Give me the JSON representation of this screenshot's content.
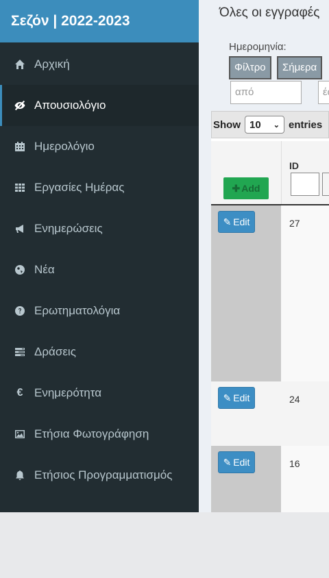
{
  "brand": "Σεζόν | 2022-2023",
  "sidebar": {
    "items": [
      {
        "label": "Αρχική",
        "icon": "home-icon",
        "active": false
      },
      {
        "label": "Απουσιολόγιο",
        "icon": "eye-slash-icon",
        "active": true
      },
      {
        "label": "Ημερολόγιο",
        "icon": "calendar-icon",
        "active": false
      },
      {
        "label": "Εργασίες Ημέρας",
        "icon": "grid-icon",
        "active": false
      },
      {
        "label": "Ενημερώσεις",
        "icon": "bullhorn-icon",
        "active": false
      },
      {
        "label": "Νέα",
        "icon": "globe-icon",
        "active": false
      },
      {
        "label": "Ερωτηματολόγια",
        "icon": "question-circle-icon",
        "active": false
      },
      {
        "label": "Δράσεις",
        "icon": "tasks-icon",
        "active": false
      },
      {
        "label": "Ενημερότητα",
        "icon": "euro-icon",
        "active": false
      },
      {
        "label": "Ετήσια Φωτογράφηση",
        "icon": "image-icon",
        "active": false
      },
      {
        "label": "Ετήσιος Προγραμματισμός",
        "icon": "bell-icon",
        "active": false
      }
    ]
  },
  "main": {
    "heading": "Όλες οι εγγραφές",
    "filter": {
      "date_label": "Ημερομηνία:",
      "filter_button": "Φίλτρο",
      "today_button": "Σήμερα",
      "from_placeholder": "από",
      "to_placeholder": "έως"
    },
    "table": {
      "show_label": "Show",
      "show_value": "10",
      "entries_label": "entries",
      "add_button": "Add",
      "id_header": "ID",
      "edit_label": "Edit",
      "rows": [
        {
          "id": "27"
        },
        {
          "id": "24"
        },
        {
          "id": "16"
        }
      ]
    }
  },
  "colors": {
    "brand": "#3c8dbc",
    "sidebar_bg": "#222d32",
    "add_button": "#21a651",
    "edit_button": "#3d8ec4"
  }
}
